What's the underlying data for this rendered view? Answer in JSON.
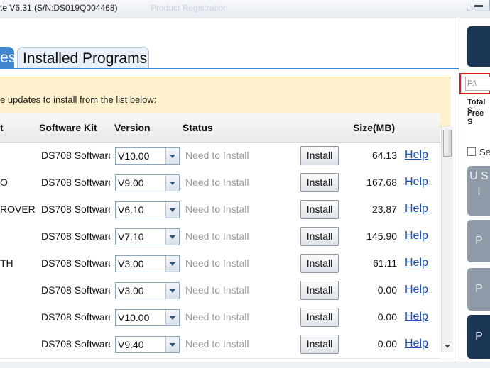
{
  "window": {
    "title": "te V6.31  (S/N:DS019Q004468)",
    "faded_title": "Product Registration"
  },
  "tabs": [
    {
      "label": "es",
      "active": true
    },
    {
      "label": "Installed Programs",
      "active": false
    }
  ],
  "notice": {
    "text": "e updates to install from the list below:"
  },
  "table": {
    "columns": [
      "t",
      "Software Kit",
      "Version",
      "Status",
      "Size(MB)"
    ],
    "rows": [
      {
        "name": "",
        "kit": "DS708 Software",
        "version": "V10.00",
        "status": "Need to Install",
        "action": "Install",
        "size": "64.13",
        "help": "Help"
      },
      {
        "name": "O",
        "kit": "DS708 Software",
        "version": "V9.00",
        "status": "Need to Install",
        "action": "Install",
        "size": "167.68",
        "help": "Help"
      },
      {
        "name": "ROVER",
        "kit": "DS708 Software",
        "version": "V6.10",
        "status": "Need to Install",
        "action": "Install",
        "size": "23.87",
        "help": "Help"
      },
      {
        "name": "",
        "kit": "DS708 Software",
        "version": "V7.10",
        "status": "Need to Install",
        "action": "Install",
        "size": "145.90",
        "help": "Help"
      },
      {
        "name": "TH",
        "kit": "DS708 Software",
        "version": "V3.00",
        "status": "Need to Install",
        "action": "Install",
        "size": "61.11",
        "help": "Help"
      },
      {
        "name": "",
        "kit": "DS708 Software",
        "version": "V3.00",
        "status": "Need to Install",
        "action": "Install",
        "size": "0.00",
        "help": "Help"
      },
      {
        "name": "",
        "kit": "DS708 Software",
        "version": "V10.00",
        "status": "Need to Install",
        "action": "Install",
        "size": "0.00",
        "help": "Help"
      },
      {
        "name": "",
        "kit": "DS708 Software",
        "version": "V9.40",
        "status": "Need to Install",
        "action": "Install",
        "size": "0.00",
        "help": "Help"
      }
    ]
  },
  "side_panel": {
    "path_value": "F:\\",
    "total_label": "Total S",
    "free_label": "Free S",
    "select_label": "Se",
    "button1_label": "U S I",
    "button2_label": "P",
    "button3_label": "P",
    "button4_label": "P"
  },
  "colors": {
    "tab_blue": "#3f86cf",
    "notice_bg": "#fdf1cd",
    "dark_button": "#1b3555",
    "highlight_border": "#e01b24"
  }
}
